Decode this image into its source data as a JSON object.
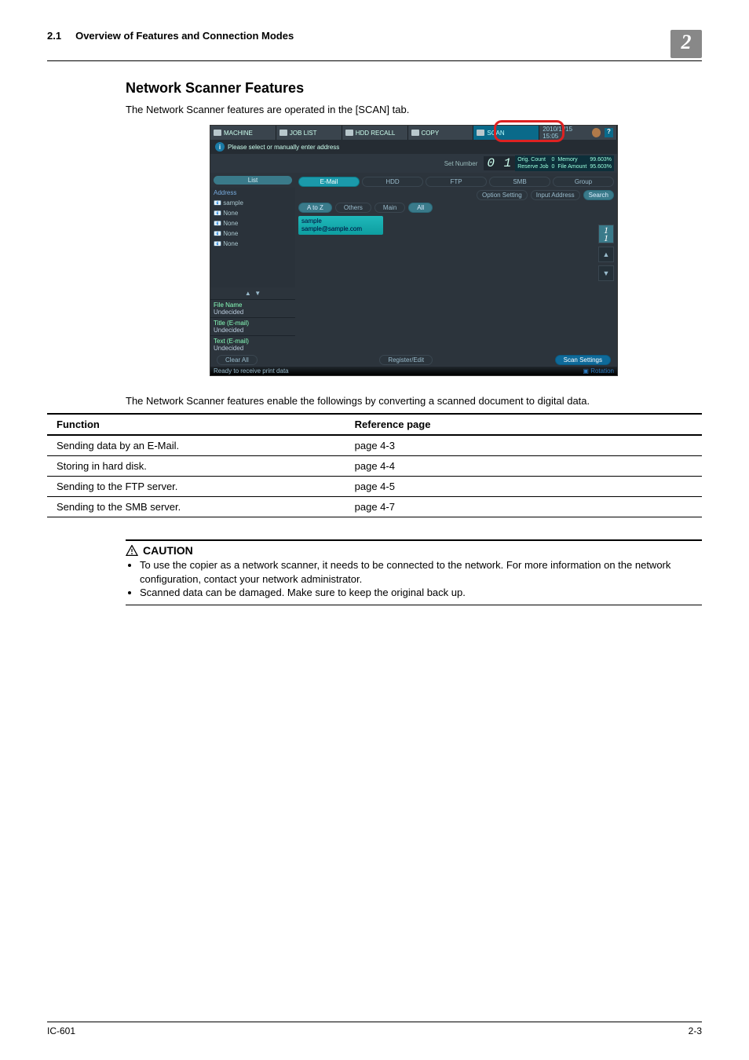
{
  "header": {
    "section_no": "2.1",
    "section_title": "Overview of Features and Connection Modes",
    "chapter_badge": "2"
  },
  "section": {
    "title": "Network Scanner Features",
    "intro": "The Network Scanner features are operated in the [SCAN] tab."
  },
  "screenshot": {
    "tabs": {
      "machine": "MACHINE",
      "job_list": "JOB LIST",
      "hdd_recall": "HDD RECALL",
      "copy": "COPY",
      "scan": "SCAN",
      "timestamp": "2010/1 /15 15:05"
    },
    "prompt": "Please select or manually enter address",
    "set_number_label": "Set Number",
    "set_number_value": "0 1",
    "status": {
      "orig_count_label": "Orig. Count",
      "orig_count_val": "0",
      "memory_label": "Memory",
      "memory_val": "99.603%",
      "reserve_label": "Reserve Job",
      "reserve_val": "0",
      "file_amount_label": "File Amount",
      "file_amount_val": "95.603%"
    },
    "sidebar": {
      "list_btn": "List",
      "address_label": "Address",
      "items": [
        "sample",
        "None",
        "None",
        "None",
        "None"
      ],
      "file_name_label": "File Name",
      "file_name_val": "Undecided",
      "title_label": "Title (E-mail)",
      "title_val": "Undecided",
      "text_label": "Text (E-mail)",
      "text_val": "Undecided"
    },
    "dest_tabs": [
      "E-Mail",
      "HDD",
      "FTP",
      "SMB",
      "Group"
    ],
    "opt_buttons": {
      "option": "Option Setting",
      "input": "Input Address",
      "search": "Search"
    },
    "filter": [
      "A to Z",
      "Others",
      "Main",
      "All"
    ],
    "entry": {
      "name": "sample",
      "addr": "sample@sample.com"
    },
    "scroll_count": "1\n1",
    "bottom": {
      "clear": "Clear All",
      "register": "Register/Edit",
      "scan_settings": "Scan Settings"
    },
    "footer_status": "Ready to receive print data",
    "footer_rotation": "Rotation"
  },
  "func_intro": "The Network Scanner features enable the followings by converting a scanned document to digital data.",
  "func_table": {
    "headers": {
      "function": "Function",
      "ref": "Reference page"
    },
    "rows": [
      {
        "func": "Sending data by an E-Mail.",
        "ref": "page 4-3"
      },
      {
        "func": "Storing in hard disk.",
        "ref": "page 4-4"
      },
      {
        "func": "Sending to the FTP server.",
        "ref": "page 4-5"
      },
      {
        "func": "Sending to the SMB server.",
        "ref": "page 4-7"
      }
    ]
  },
  "caution": {
    "heading": "CAUTION",
    "items": [
      "To use the copier as a network scanner, it needs to be connected to the network.   For more information on the network configuration, contact your network administrator.",
      "Scanned data can be damaged. Make sure to keep the original back up."
    ]
  },
  "page_footer": {
    "left": "IC-601",
    "right": "2-3"
  }
}
